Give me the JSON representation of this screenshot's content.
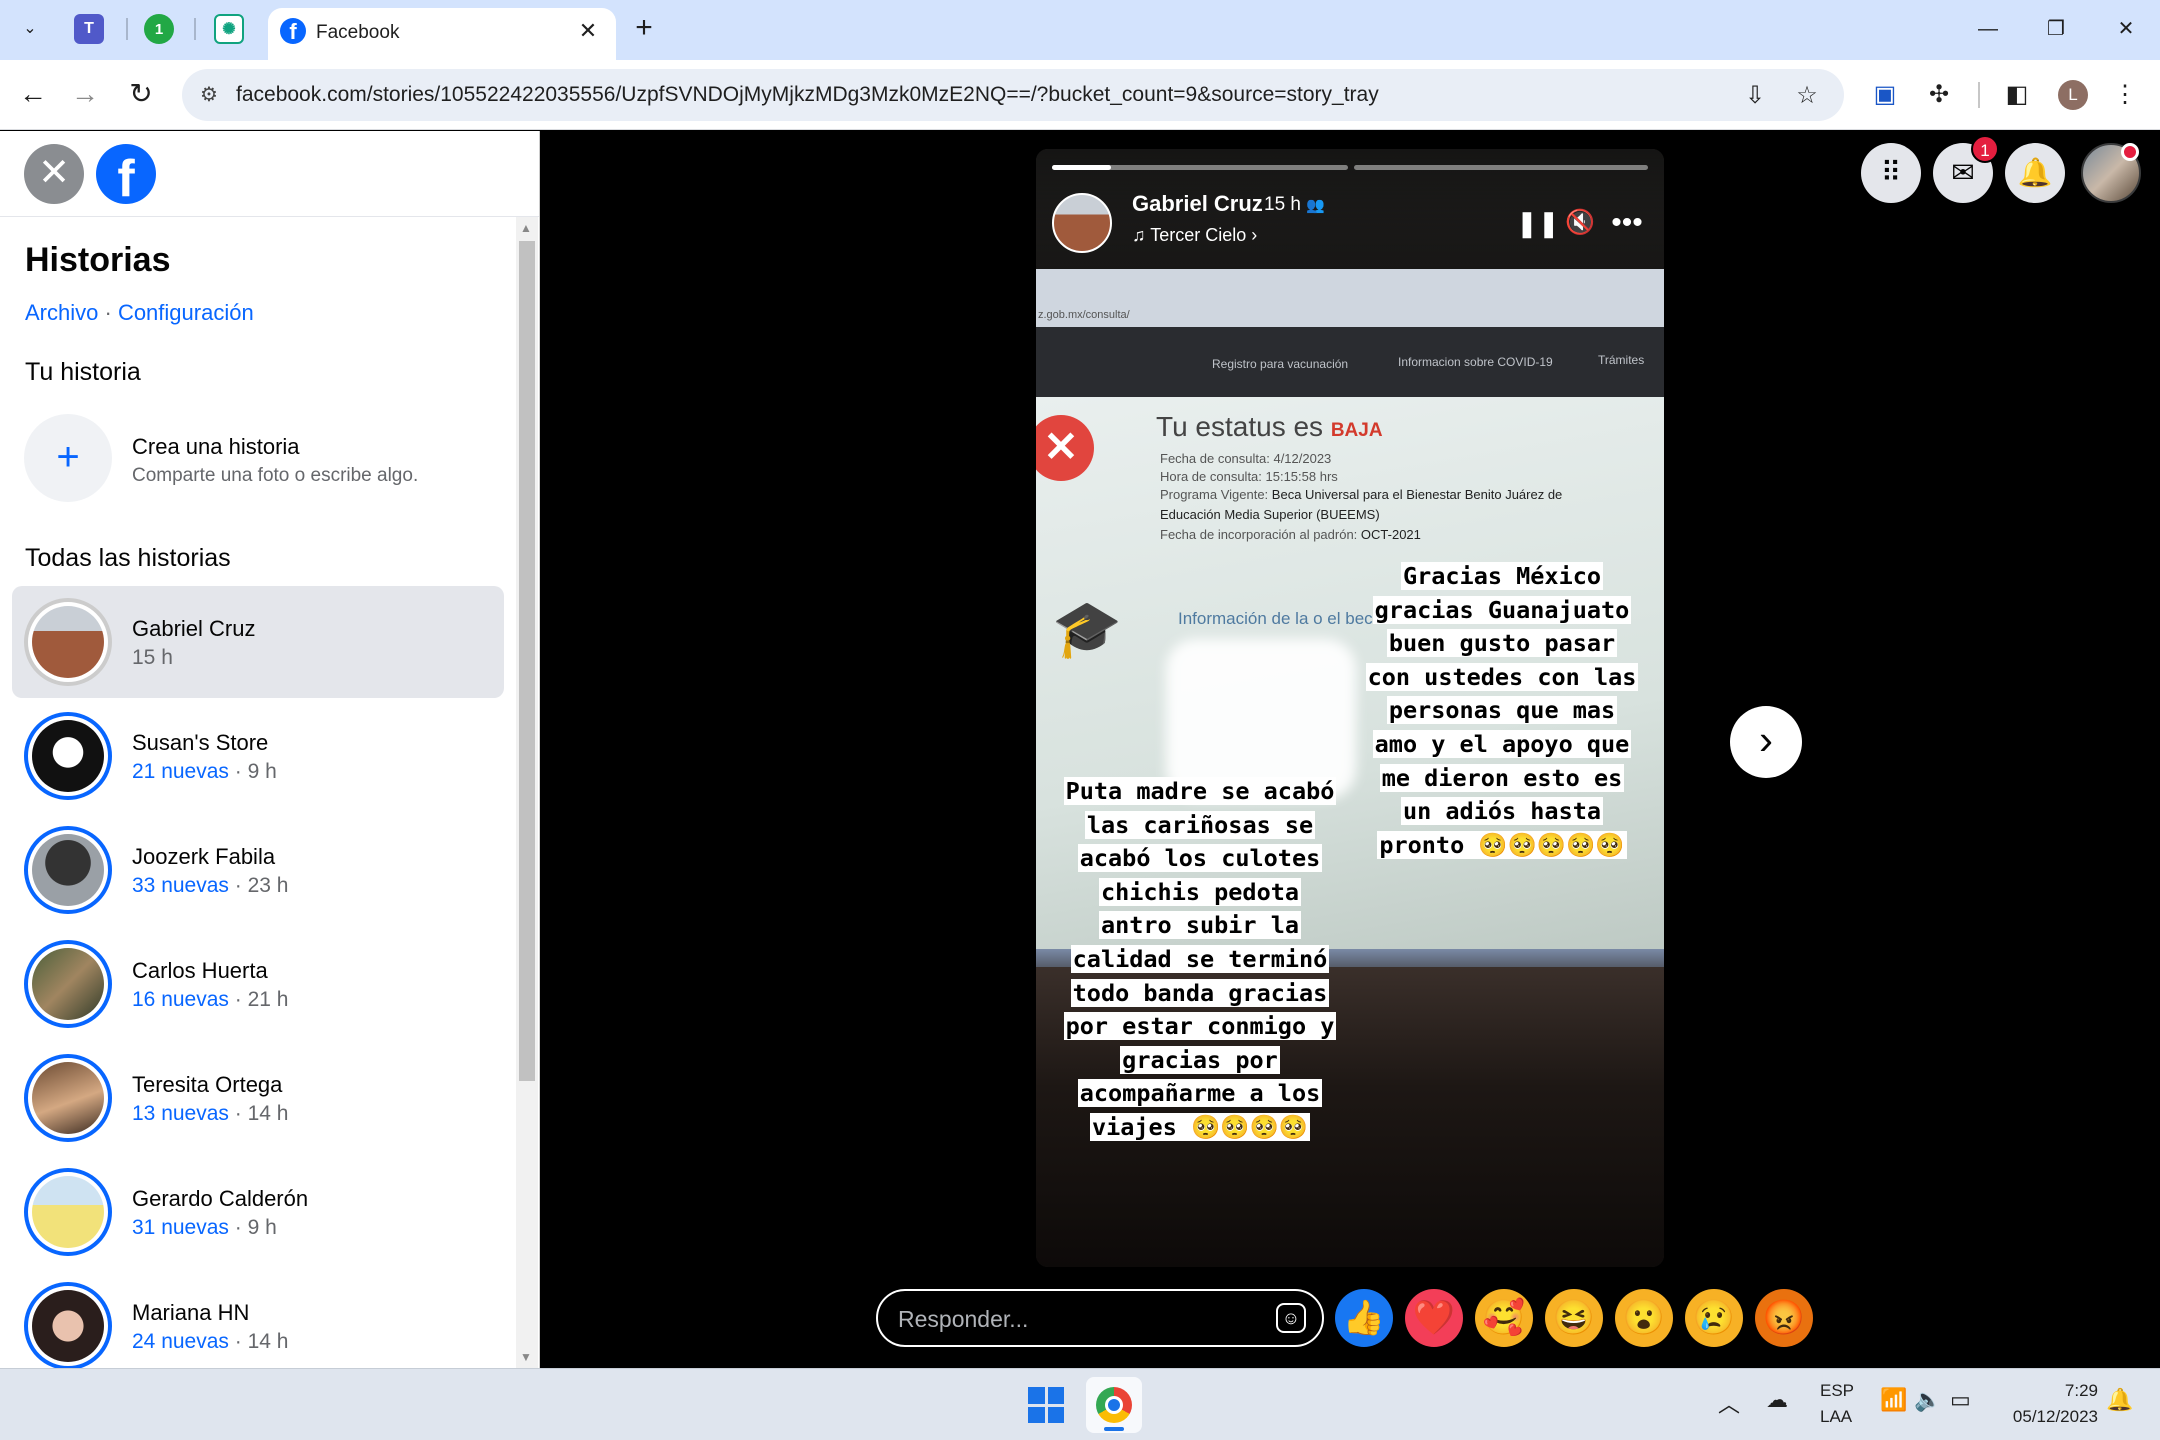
{
  "browser": {
    "tab_title": "Facebook",
    "url": "facebook.com/stories/105522422035556/UzpfSVNDOjMyMjkzMDg3Mzk0MzE2NQ==/?bucket_count=9&source=story_tray",
    "pinned_badge": "1",
    "profile_initial": "L"
  },
  "sidebar": {
    "heading": "Historias",
    "link_archive": "Archivo",
    "link_separator": "·",
    "link_settings": "Configuración",
    "your_story_heading": "Tu historia",
    "create_title": "Crea una historia",
    "create_subtitle": "Comparte una foto o escribe algo.",
    "all_stories_heading": "Todas las historias",
    "stories": [
      {
        "name": "Gabriel Cruz",
        "new": "",
        "time": "15 h",
        "selected": true
      },
      {
        "name": "Susan's Store",
        "new": "21 nuevas",
        "time": "9 h"
      },
      {
        "name": "Joozerk Fabila",
        "new": "33 nuevas",
        "time": "23 h"
      },
      {
        "name": "Carlos Huerta",
        "new": "16 nuevas",
        "time": "21 h"
      },
      {
        "name": "Teresita Ortega",
        "new": "13 nuevas",
        "time": "14 h"
      },
      {
        "name": "Gerardo Calderón",
        "new": "31 nuevas",
        "time": "9 h"
      },
      {
        "name": "Mariana HN",
        "new": "24 nuevas",
        "time": "14 h"
      }
    ]
  },
  "story": {
    "author": "Gabriel Cruz",
    "time": "15 h",
    "music": "Tercer Cielo",
    "progress_current": 0.2,
    "photo": {
      "url_fragment": "z.gob.mx/consulta/",
      "nav_1": "Registro para vacunación",
      "nav_2": "Informacion sobre COVID-19",
      "nav_3": "Trámites",
      "status_prefix": "Tu estatus es",
      "status_value": "BAJA",
      "line_1": "Fecha de consulta: 4/12/2023",
      "line_2": "Hora de consulta: 15:15:58 hrs",
      "line_3_label": "Programa Vigente:",
      "line_3_value": "Beca Universal para el Bienestar Benito Juárez de",
      "line_4": "Educación Media Superior (BUEEMS)",
      "line_5_label": "Fecha de incorporación al padrón:",
      "line_5_value": "OCT-2021",
      "info_label": "Información de la o el bec..."
    },
    "caption_right": [
      "Gracias México",
      "gracias Guanajuato",
      "buen gusto pasar",
      "con ustedes con las",
      "personas que mas",
      "amo y el apoyo que",
      "me dieron esto es",
      "un adiós hasta",
      "pronto 🥺🥺🥺🥺🥺"
    ],
    "caption_left": [
      "Puta madre se acabó",
      "las cariñosas se",
      "acabó los culotes",
      "chichis pedota",
      "antro subir la",
      "calidad se terminó",
      "todo banda gracias",
      "por estar conmigo y",
      "gracias por",
      "acompañarme a los",
      "viajes 🥺🥺🥺🥺"
    ]
  },
  "header": {
    "messenger_badge": "1"
  },
  "reply": {
    "placeholder": "Responder..."
  },
  "reactions": [
    "👍",
    "❤️",
    "🥰",
    "😆",
    "😮",
    "😢",
    "😡"
  ],
  "taskbar": {
    "lang_1": "ESP",
    "lang_2": "LAA",
    "time": "7:29",
    "date": "05/12/2023"
  }
}
